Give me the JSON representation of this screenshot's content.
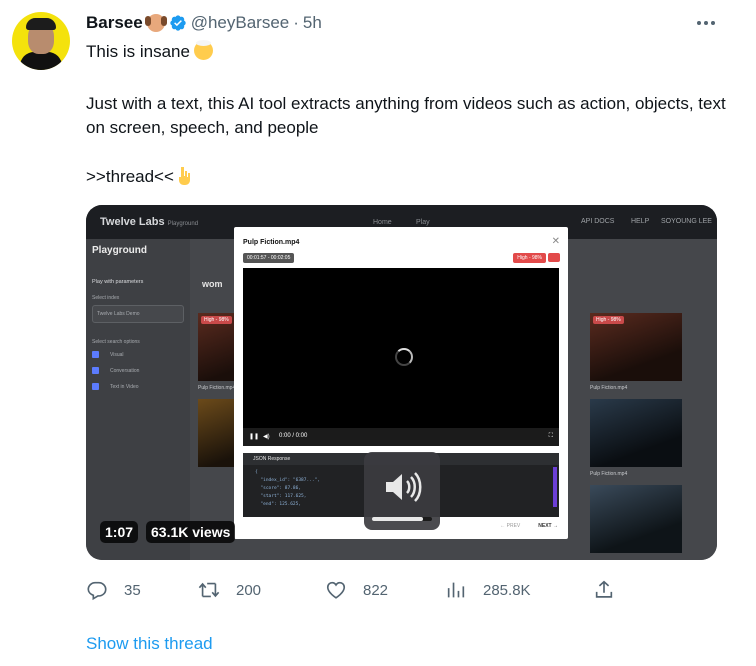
{
  "author": {
    "name": "Barsee",
    "handle": "@heyBarsee",
    "separator": "·",
    "time": "5h"
  },
  "tweet": {
    "line1": "This is insane",
    "paragraph": "Just with a text, this AI tool extracts anything from videos such as action, objects, text on screen, speech, and people",
    "thread_line": ">>thread<<"
  },
  "video": {
    "duration": "1:07",
    "views": "63.1K views",
    "app": {
      "logo": "Twelve Labs",
      "logo_sub": "Playground",
      "nav_home": "Home",
      "nav_play": "Play",
      "api_docs": "API DOCS",
      "help": "HELP",
      "user": "SOYOUNG LEE",
      "sidebar_title": "Playground",
      "play_params": "Play with parameters",
      "select_index": "Select index",
      "index_value": "Twelve Labs Demo",
      "search_options": "Select search options",
      "opt_visual": "Visual",
      "opt_conversation": "Conversation",
      "opt_text": "Text in Video",
      "search_query": "wom",
      "modal_title": "Pulp Fiction.mp4",
      "timecode": "00:01:57 - 00:02:05",
      "confidence": "High - 98%",
      "player_time": "0:00 / 0:00",
      "json_title": "JSON Response",
      "json_lines": [
        "{",
        "  \"index_id\": \"6387...\",",
        "  \"score\": 87.86,",
        "  \"start\": 117.625,",
        "  \"end\": 125.625,"
      ],
      "prev": "PREV",
      "next": "NEXT",
      "thumb_label": "Pulp Fiction.mp4",
      "badge_high": "High - 98%",
      "volume_level": 0.85
    }
  },
  "actions": {
    "replies": "35",
    "retweets": "200",
    "likes": "822",
    "views": "285.8K"
  },
  "show_thread": "Show this thread",
  "colors": {
    "link": "#1d9bf0",
    "muted": "#536471",
    "verified": "#1d9bf0"
  }
}
